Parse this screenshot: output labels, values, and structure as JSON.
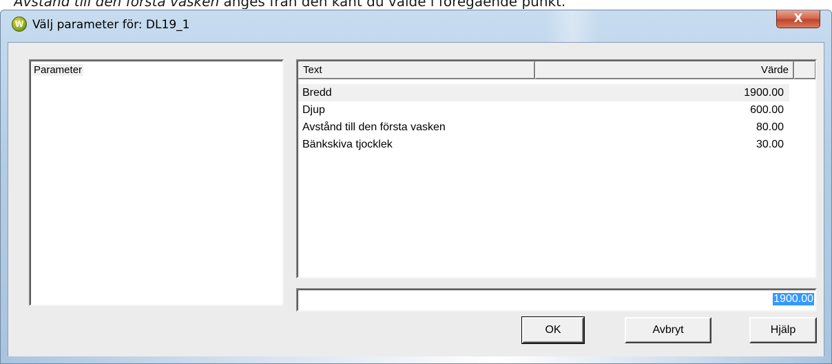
{
  "document": {
    "text_italic": "Avstånd till den första vasken",
    "text_rest": " anges från den kant du valde i föregående punkt."
  },
  "window": {
    "title": "Välj parameter för: DL19_1",
    "icon_letter": "W",
    "close_label": "X"
  },
  "left_panel": {
    "label": "Parameter"
  },
  "table": {
    "headers": {
      "text": "Text",
      "value": "Värde"
    },
    "rows": [
      {
        "text": "Bredd",
        "value": "1900.00",
        "selected": true
      },
      {
        "text": "Djup",
        "value": "600.00"
      },
      {
        "text": "Avstånd till den första vasken",
        "value": "80.00"
      },
      {
        "text": "Bänkskiva tjocklek",
        "value": "30.00"
      }
    ]
  },
  "input": {
    "value": "1900.00"
  },
  "buttons": {
    "ok": "OK",
    "cancel": "Avbryt",
    "help": "Hjälp"
  }
}
